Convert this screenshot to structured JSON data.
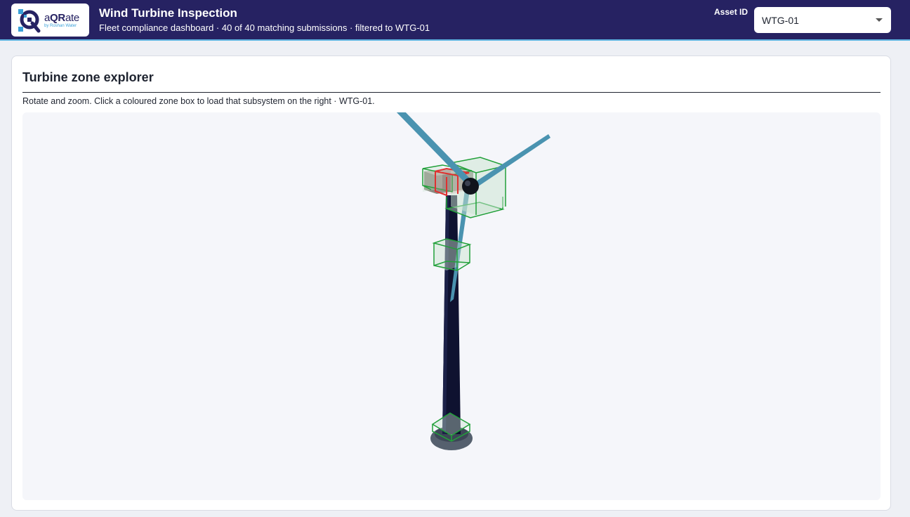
{
  "header": {
    "logo": {
      "icon": "qr-logo-icon",
      "word_prefix": "a",
      "word_bold": "QR",
      "word_suffix": "ate",
      "tagline": "by Roshan Water"
    },
    "title": "Wind Turbine Inspection",
    "subtitle": "Fleet compliance dashboard · 40 of 40 matching submissions · filtered to WTG-01",
    "asset_label": "Asset ID",
    "asset_value": "WTG-01",
    "asset_caret_icon": "caret-down-icon"
  },
  "explorer": {
    "title": "Turbine zone explorer",
    "description": "Rotate and zoom. Click a coloured zone box to load that subsystem on the right · WTG-01.",
    "zones": [
      {
        "id": "nacelle-rear",
        "status": "ok",
        "color": "#22a03a"
      },
      {
        "id": "nacelle-front",
        "status": "flagged",
        "color": "#e03030"
      },
      {
        "id": "nacelle-top",
        "status": "ok",
        "color": "#22a03a"
      },
      {
        "id": "nacelle-lower",
        "status": "ok",
        "color": "#22a03a"
      },
      {
        "id": "tower-mid",
        "status": "ok",
        "color": "#22a03a"
      },
      {
        "id": "tower-base",
        "status": "ok",
        "color": "#22a03a"
      }
    ],
    "colors": {
      "tower": "#0f1230",
      "blade": "#4a93b0",
      "hub": "#10141c",
      "nacelle": "#8a8a80",
      "base": "#55606e",
      "zone_fill": "#c9e3cf"
    }
  }
}
